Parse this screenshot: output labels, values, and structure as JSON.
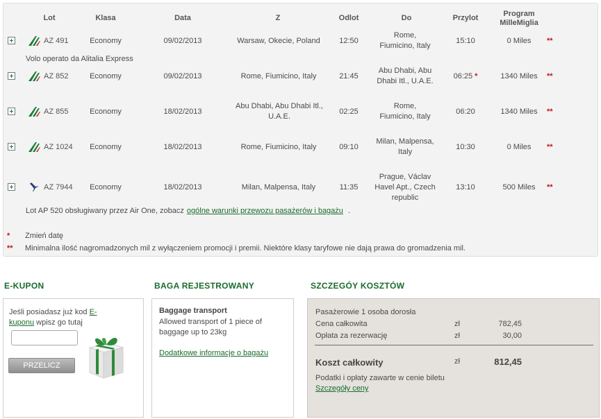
{
  "headers": {
    "flight": "Lot",
    "class": "Klasa",
    "date": "Data",
    "from": "Z",
    "departure": "Odlot",
    "to": "Do",
    "arrival": "Przylot",
    "program_line1": "Program",
    "program_line2": "MilleMiglia"
  },
  "flights": [
    {
      "airline_icon": "alitalia-logo-icon",
      "number": "AZ 491",
      "class": "Economy",
      "date": "09/02/2013",
      "from": "Warsaw, Okecie, Poland",
      "departure": "12:50",
      "to": "Rome, Fiumicino, Italy",
      "arrival": "15:10",
      "arrival_mark": "",
      "miles": "0 Miles",
      "mark": "**"
    },
    {
      "airline_icon": "alitalia-logo-icon",
      "number": "AZ 852",
      "class": "Economy",
      "date": "09/02/2013",
      "from": "Rome, Fiumicino, Italy",
      "departure": "21:45",
      "to": "Abu Dhabi, Abu Dhabi Itl., U.A.E.",
      "arrival": "06:25",
      "arrival_mark": "*",
      "miles": "1340 Miles",
      "mark": "**"
    },
    {
      "airline_icon": "alitalia-logo-icon",
      "number": "AZ 855",
      "class": "Economy",
      "date": "18/02/2013",
      "from": "Abu Dhabi, Abu Dhabi Itl., U.A.E.",
      "departure": "02:25",
      "to": "Rome, Fiumicino, Italy",
      "arrival": "06:20",
      "arrival_mark": "",
      "miles": "1340 Miles",
      "mark": "**"
    },
    {
      "airline_icon": "alitalia-logo-icon",
      "number": "AZ 1024",
      "class": "Economy",
      "date": "18/02/2013",
      "from": "Rome, Fiumicino, Italy",
      "departure": "09:10",
      "to": "Milan, Malpensa, Italy",
      "arrival": "10:30",
      "arrival_mark": "",
      "miles": "0 Miles",
      "mark": "**"
    },
    {
      "airline_icon": "airone-logo-icon",
      "number": "AZ 7944",
      "class": "Economy",
      "date": "18/02/2013",
      "from": "Milan, Malpensa, Italy",
      "departure": "11:35",
      "to": "Prague, Václav Havel Apt., Czech republic",
      "arrival": "13:10",
      "arrival_mark": "",
      "miles": "500 Miles",
      "mark": "**"
    }
  ],
  "notes": {
    "operated_by": "Volo operato da Alitalia Express",
    "airone_text": "Lot AP 520 obsługiwany przez Air One, zobacz",
    "airone_link": "ogólne warunki przewozu pasażerów i bagażu",
    "airone_end": "."
  },
  "legend": {
    "single_symbol": "*",
    "single_text": "Zmień datę",
    "double_symbol": "**",
    "double_text": "Minimalna ilość nagromadzonych mil z wyłączeniem promocji i premii. Niektóre klasy taryfowe nie dają prawa do gromadzenia mil."
  },
  "ekupon": {
    "title": "E-KUPON",
    "text_before": "Jeśli posiadasz już kod",
    "link": "E-kuponu",
    "text_after": "wpisz go tutaj",
    "input_value": "",
    "button_label": "PRZELICZ"
  },
  "baggage": {
    "title": "BAGA REJESTROWANY",
    "heading": "Baggage transport",
    "description": "Allowed transport of 1 piece of baggage up to 23kg",
    "link": "Dodatkowe informacje o bagażu"
  },
  "costs": {
    "title": "SZCZEGÓY KOSZTÓW",
    "passengers": "Pasażerowie  1 osoba dorosła",
    "total_price_label": "Cena całkowita",
    "total_price_currency": "zł",
    "total_price_value": "782,45",
    "booking_fee_label": "Opłata za rezerwację",
    "booking_fee_currency": "zł",
    "booking_fee_value": "30,00",
    "grand_total_label": "Koszt całkowity",
    "grand_total_currency": "zł",
    "grand_total_value": "812,45",
    "taxes_note": "Podatki i opłaty zawarte w cenie biletu",
    "details_link": "Szczegóły ceny"
  },
  "colors": {
    "accent_green": "#1a6b2c",
    "alert_red": "#c0181b",
    "panel_grey": "#f3f3f3"
  }
}
